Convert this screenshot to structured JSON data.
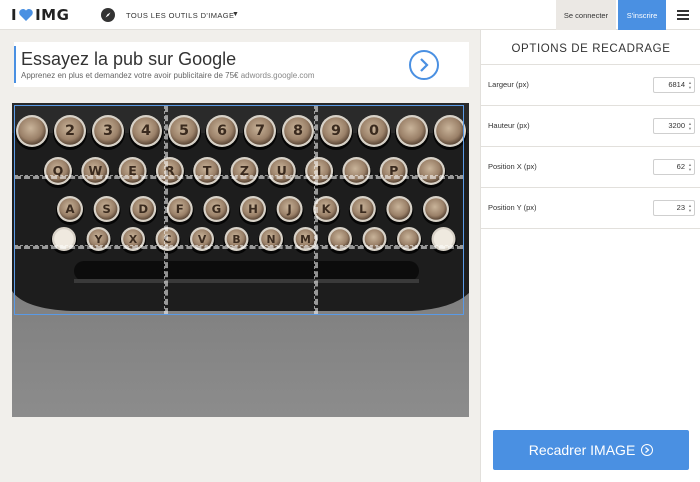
{
  "header": {
    "logo_left": "I",
    "logo_right": "IMG",
    "tools_label": "TOUS LES OUTILS D'IMAGE",
    "login_label": "Se connecter",
    "signup_label": "S'inscrire",
    "icons": {
      "logo": "heart-icon",
      "tools": "compass-icon",
      "caret": "chevron-down-icon",
      "menu": "hamburger-menu-icon"
    }
  },
  "ad": {
    "title": "Essayez la pub sur Google",
    "description": "Apprenez en plus et demandez votre avoir publicitaire de 75€",
    "domain": "adwords.google.com",
    "arrow_icon": "chevron-right-icon"
  },
  "image": {
    "subject": "typewriter-keys-photo",
    "key_rows": [
      [
        "",
        "2",
        "3",
        "4",
        "5",
        "6",
        "7",
        "8",
        "9",
        "0",
        "",
        ""
      ],
      [
        "Q",
        "W",
        "E",
        "R",
        "T",
        "Z",
        "U",
        "I",
        "",
        "P",
        ""
      ],
      [
        "A",
        "S",
        "D",
        "F",
        "G",
        "H",
        "J",
        "K",
        "L",
        "",
        ""
      ],
      [
        "",
        "Y",
        "X",
        "C",
        "V",
        "B",
        "N",
        "M",
        "",
        "",
        "",
        ""
      ]
    ]
  },
  "panel": {
    "title": "OPTIONS DE RECADRAGE",
    "fields": [
      {
        "label": "Largeur (px)",
        "value": "6814"
      },
      {
        "label": "Hauteur (px)",
        "value": "3200"
      },
      {
        "label": "Position X (px)",
        "value": "62"
      },
      {
        "label": "Position Y (px)",
        "value": "23"
      }
    ],
    "button_label": "Recadrer IMAGE",
    "button_icon": "arrow-circle-right-icon"
  },
  "colors": {
    "accent": "#4a90e2",
    "background": "#f1efeb",
    "panel": "#ffffff"
  }
}
